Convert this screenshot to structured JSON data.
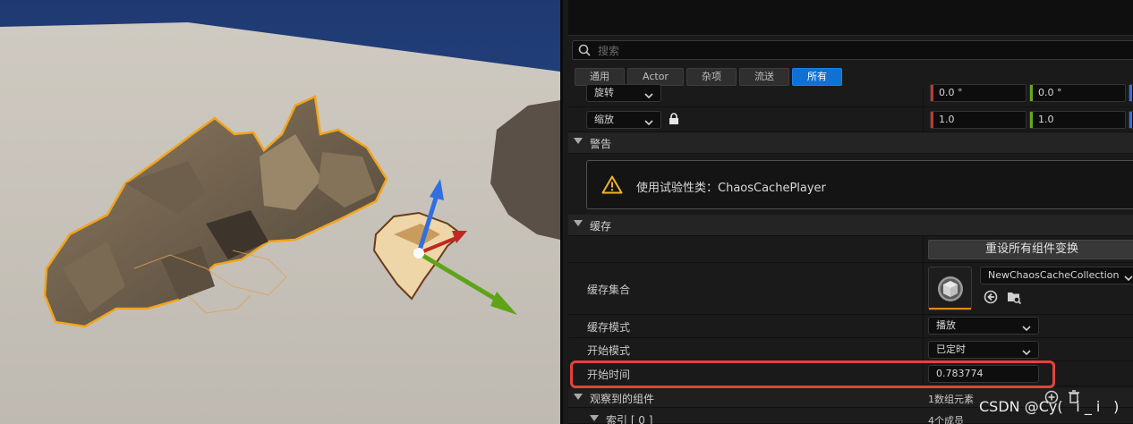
{
  "details": {
    "search": {
      "placeholder": "搜索"
    },
    "filter_tabs": [
      {
        "label": "通用",
        "active": false
      },
      {
        "label": "Actor",
        "active": false
      },
      {
        "label": "杂项",
        "active": false
      },
      {
        "label": "流送",
        "active": false
      },
      {
        "label": "所有",
        "active": true
      }
    ],
    "transform": {
      "rotation": {
        "label": "旋转",
        "values": [
          "0.0 °",
          "0.0 °"
        ]
      },
      "scale": {
        "label": "缩放",
        "values": [
          "1.0",
          "1.0"
        ]
      }
    },
    "warning": {
      "title": "警告",
      "message": "使用试验性类：ChaosCachePlayer"
    },
    "cache": {
      "title": "缓存",
      "reset_button": "重设所有组件变换",
      "collection": {
        "label": "缓存集合",
        "value": "NewChaosCacheCollection"
      },
      "cache_mode": {
        "label": "缓存模式",
        "value": "播放"
      },
      "start_mode": {
        "label": "开始模式",
        "value": "已定时"
      },
      "start_time": {
        "label": "开始时间",
        "value": "0.783774"
      }
    },
    "observed": {
      "label": "观察到的组件",
      "value": "1数组元素"
    },
    "index": {
      "label": "索引 [ 0 ]",
      "value": "4个成员"
    }
  },
  "watermark": "CSDN @Cy(ㅤi _ iㅤ)",
  "colors": {
    "accent_active": "#0e71d3",
    "highlight": "#e0443b",
    "warning": "#f0b429",
    "selection_outline": "#f2a41c"
  }
}
